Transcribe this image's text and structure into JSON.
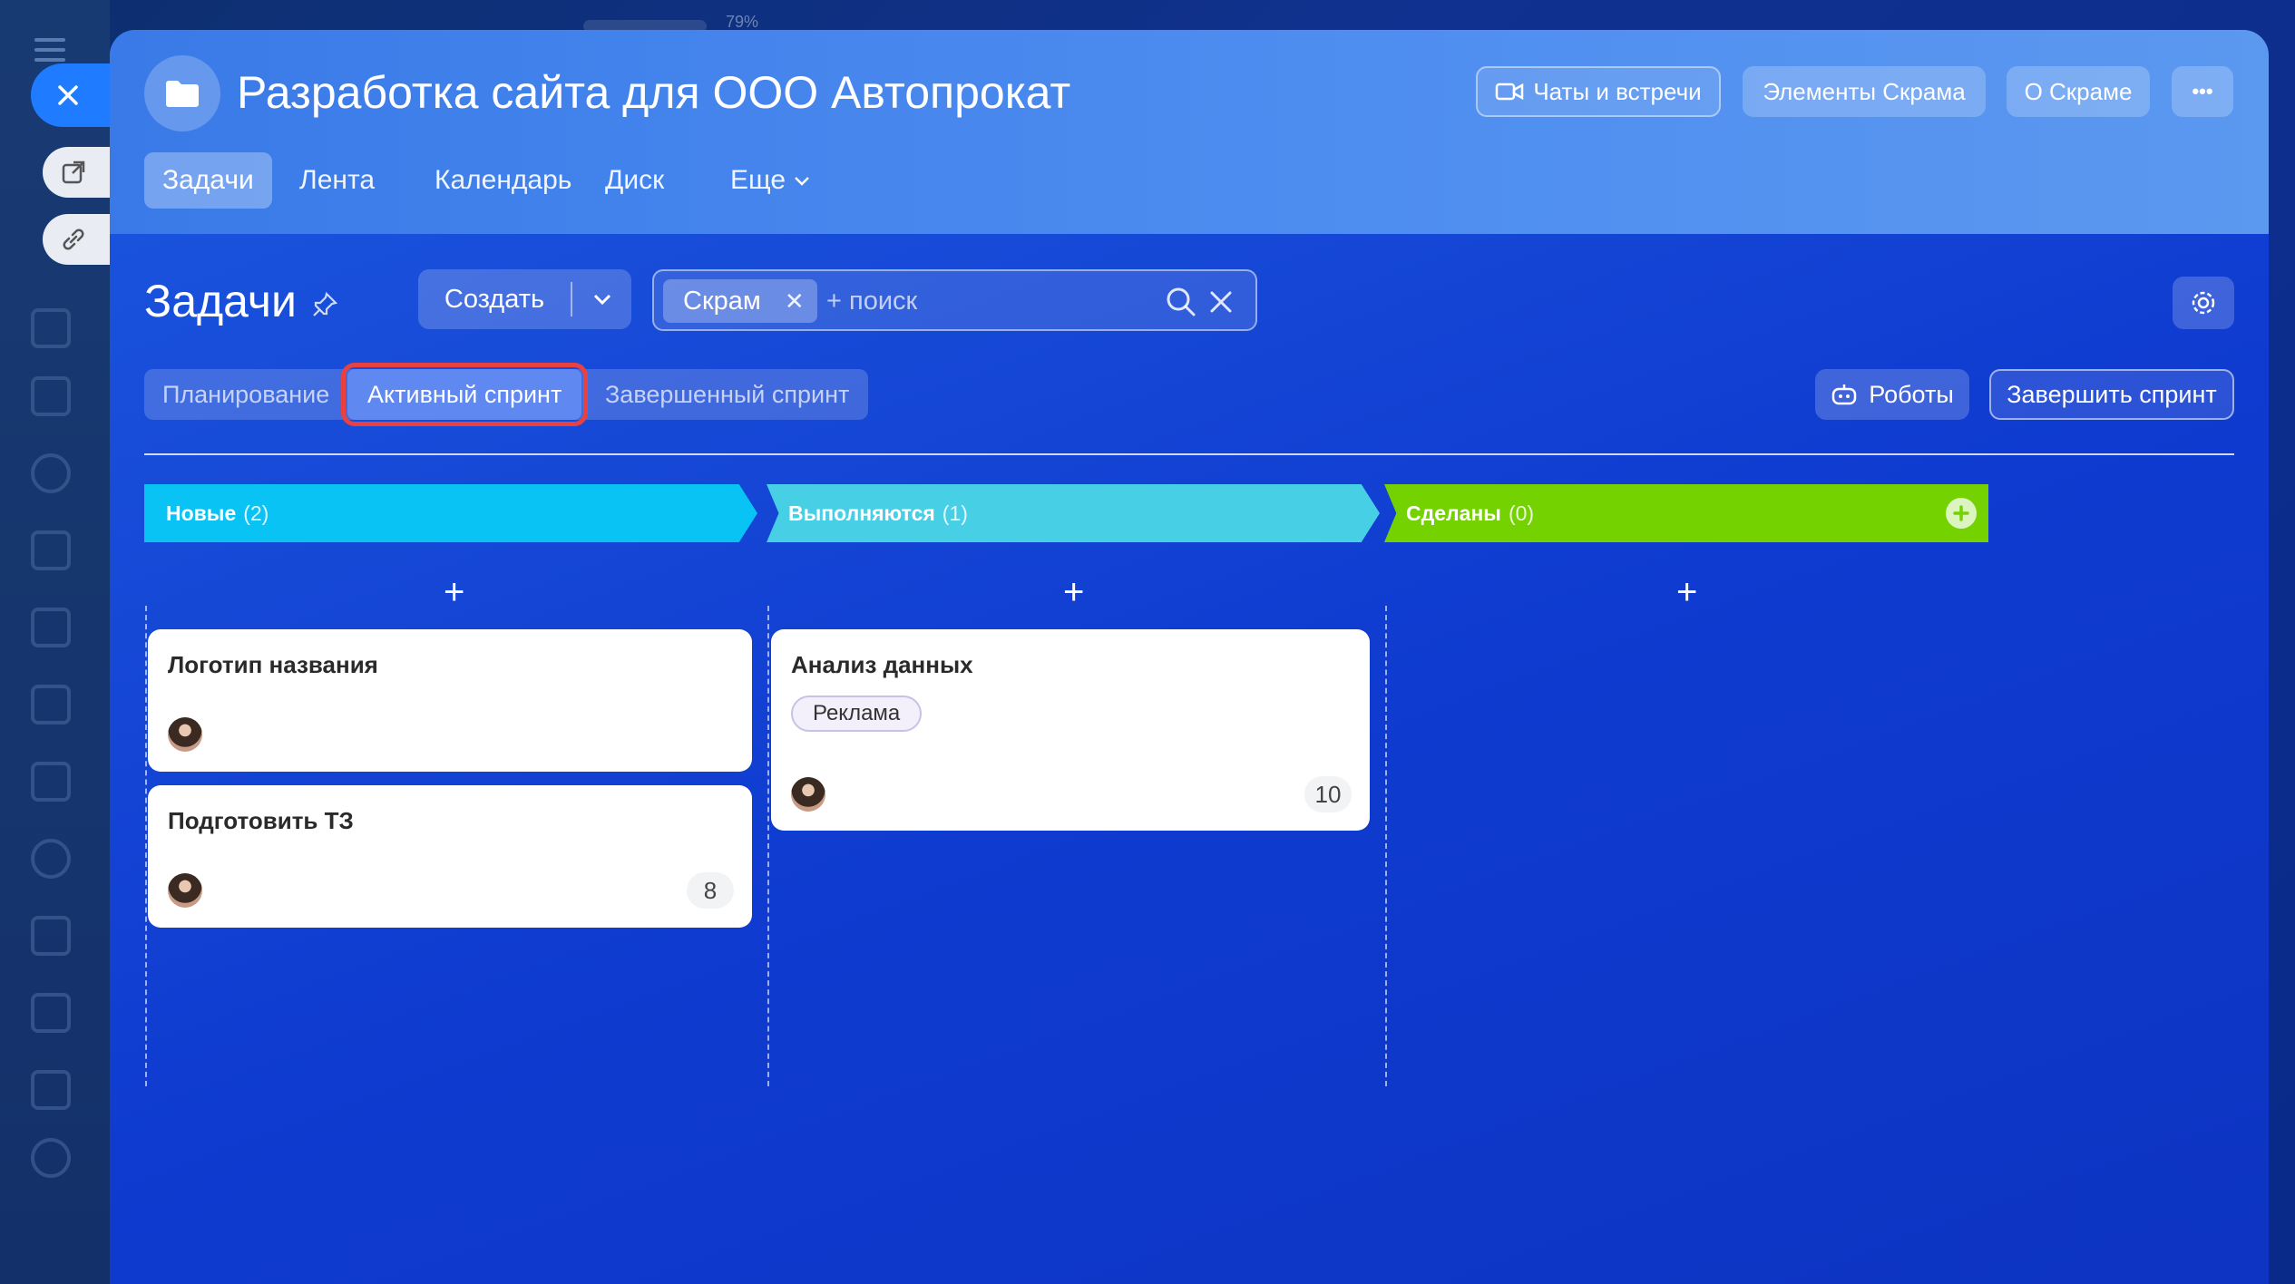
{
  "top_overlay": {
    "zoom": "79%"
  },
  "header": {
    "project_title": "Разработка сайта для ООО Автопрокат",
    "buttons": {
      "chats": "Чаты и встречи",
      "scrum_elements": "Элементы Скрама",
      "about_scrum": "О Скраме",
      "more": "•••"
    },
    "tabs": [
      "Задачи",
      "Лента",
      "Календарь",
      "Диск",
      "Еще"
    ]
  },
  "toolbar": {
    "page_title": "Задачи",
    "create_label": "Создать",
    "filter_chip": "Скрам",
    "search_placeholder": "+ поиск"
  },
  "sprint_tabs": {
    "planning": "Планирование",
    "active": "Активный спринт",
    "completed": "Завершенный спринт"
  },
  "actions": {
    "robots": "Роботы",
    "finish_sprint": "Завершить спринт"
  },
  "columns": [
    {
      "name": "Новые",
      "count": "(2)",
      "color": "#0ac3f5"
    },
    {
      "name": "Выполняются",
      "count": "(1)",
      "color": "#47cfe6"
    },
    {
      "name": "Сделаны",
      "count": "(0)",
      "color": "#74d200"
    }
  ],
  "add_symbol": "+",
  "cards": {
    "c1": {
      "title": "Логотип названия"
    },
    "c2": {
      "title": "Подготовить ТЗ",
      "count": "8"
    },
    "c3": {
      "title": "Анализ данных",
      "tag": "Реклама",
      "count": "10"
    }
  },
  "colors": {
    "accent": "#1f7bff",
    "highlight": "#e8413f"
  }
}
